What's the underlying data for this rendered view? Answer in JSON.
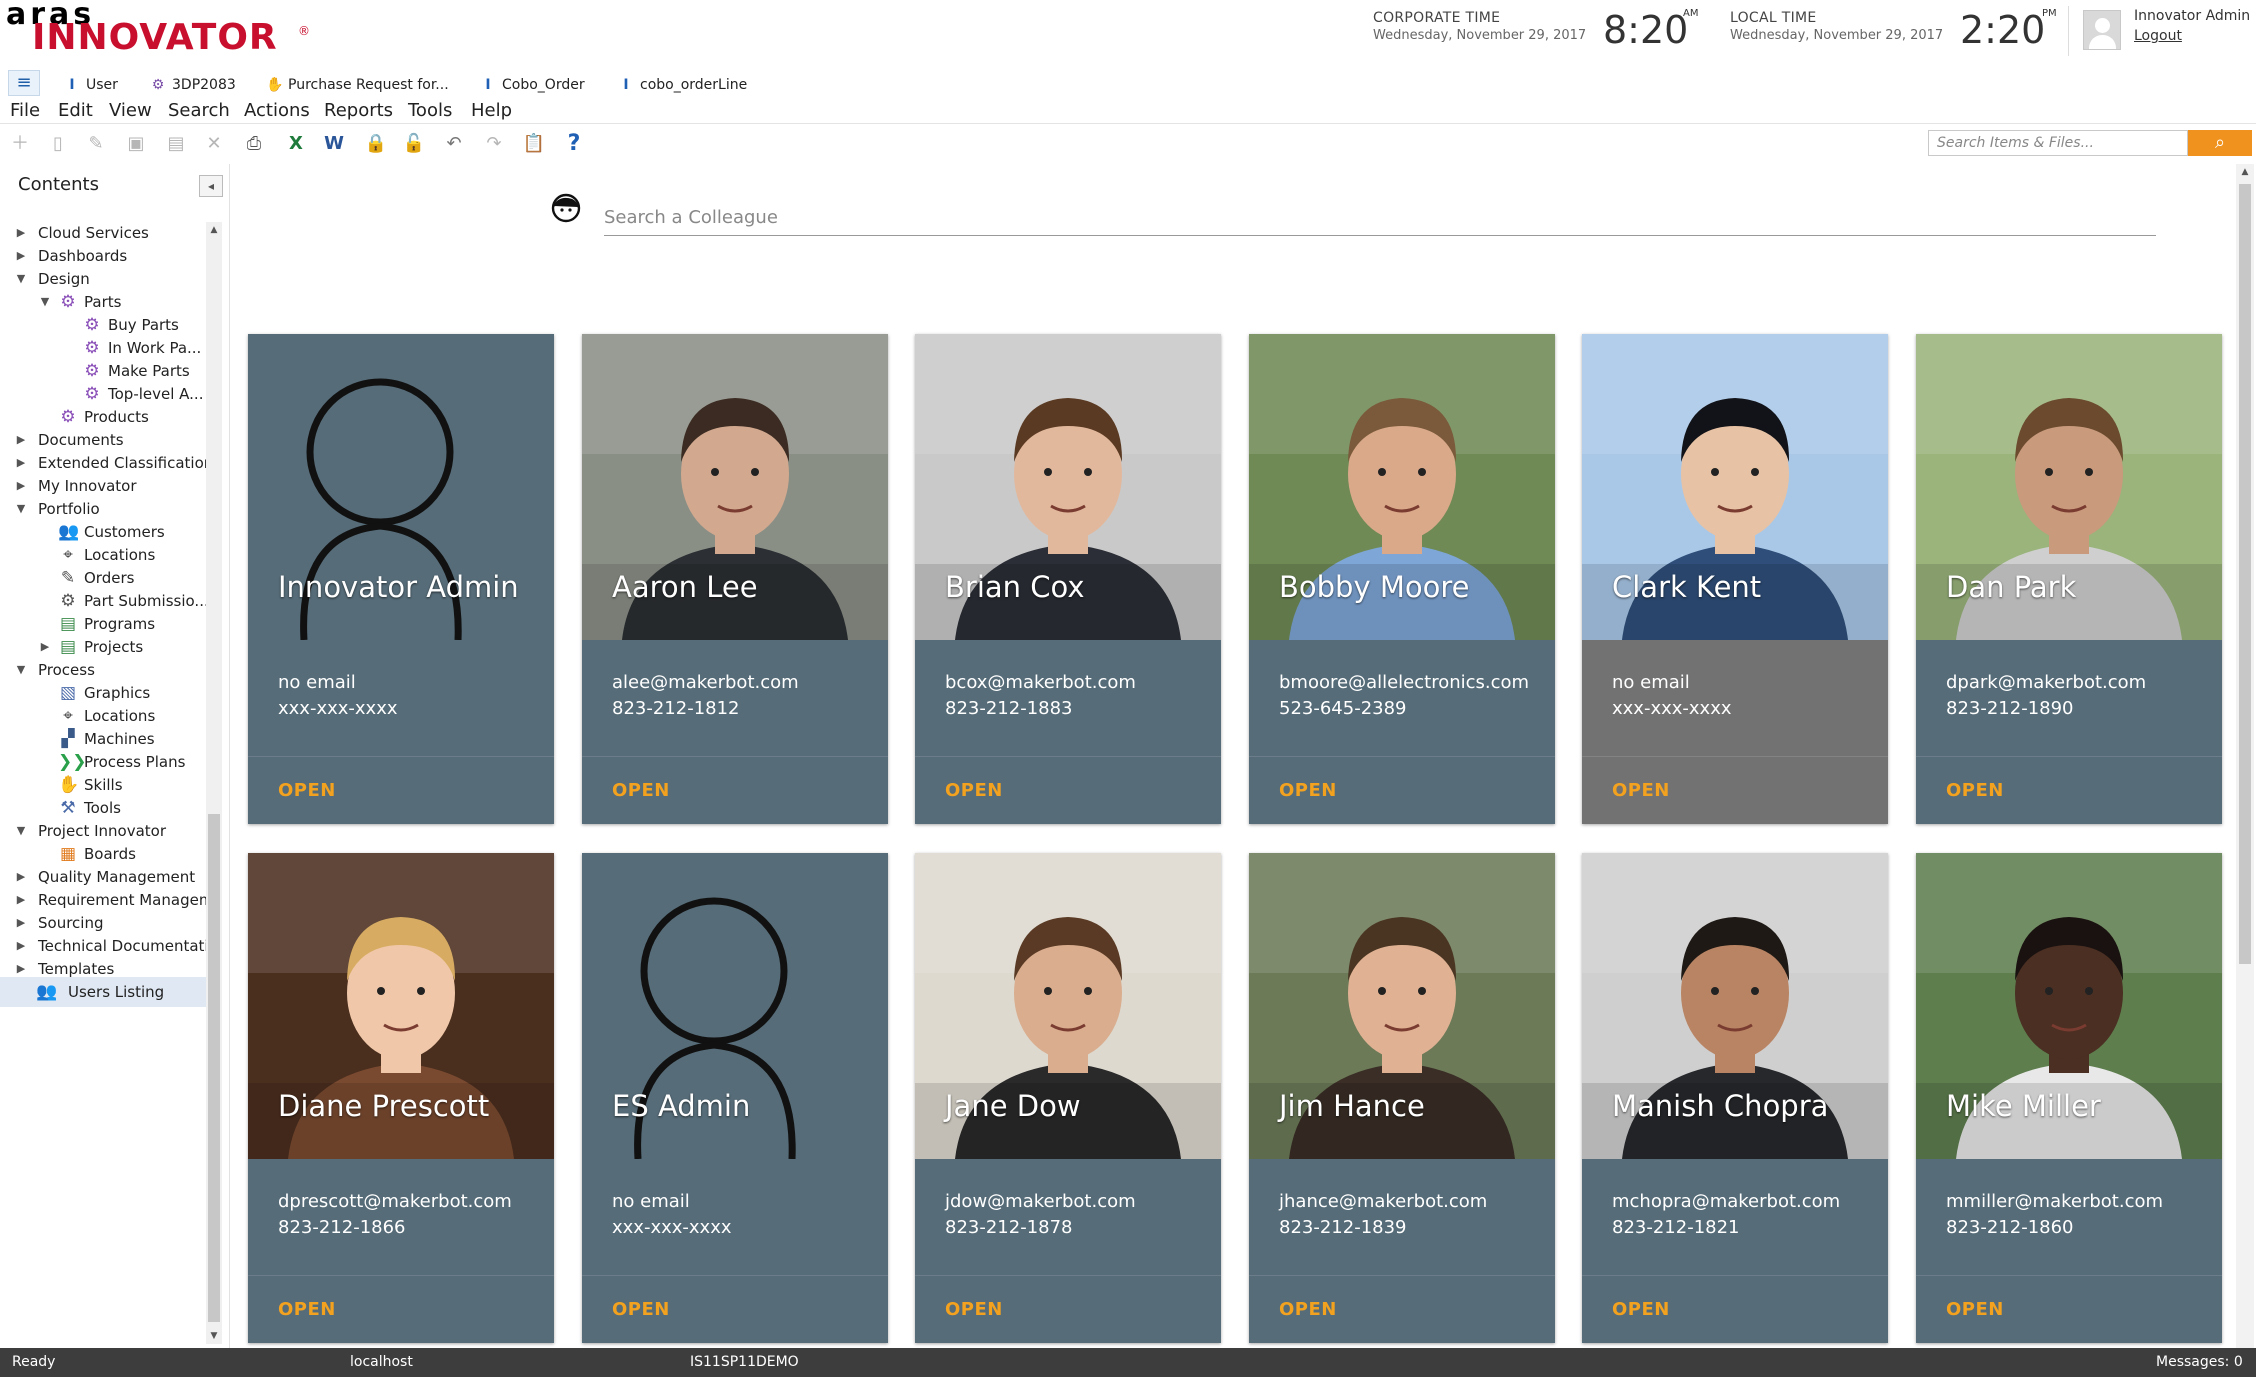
{
  "header": {
    "logo_top": "aras",
    "logo_main": "INNOVATOR",
    "logo_mark": "®",
    "corporate_time": {
      "label": "CORPORATE TIME",
      "date": "Wednesday, November 29, 2017",
      "time": "8:20",
      "ampm": "AM"
    },
    "local_time": {
      "label": "LOCAL TIME",
      "date": "Wednesday, November 29, 2017",
      "time": "2:20",
      "ampm": "PM"
    },
    "user_name": "Innovator Admin",
    "logout_label": "Logout"
  },
  "tabs": [
    {
      "label": "User",
      "icon": "user-type-icon"
    },
    {
      "label": "3DP2083",
      "icon": "part-gear-icon"
    },
    {
      "label": "Purchase Request for...",
      "icon": "purchase-request-icon"
    },
    {
      "label": "Cobo_Order",
      "icon": "itemtype-icon"
    },
    {
      "label": "cobo_orderLine",
      "icon": "itemtype-icon"
    }
  ],
  "menu": [
    "File",
    "Edit",
    "View",
    "Search",
    "Actions",
    "Reports",
    "Tools",
    "Help"
  ],
  "toolbar": {
    "icons": [
      "new-item-icon",
      "new-file-icon",
      "edit-icon",
      "save-icon",
      "save-close-icon",
      "delete-icon",
      "print-icon",
      "excel-icon",
      "word-icon",
      "lock-icon",
      "unlock-icon",
      "undo-icon",
      "redo-icon",
      "clipboard-icon",
      "help-icon"
    ],
    "search_placeholder": "Search Items & Files..."
  },
  "sidebar": {
    "title": "Contents",
    "items": [
      {
        "label": "Cloud Services",
        "level": 0,
        "arrow": "right"
      },
      {
        "label": "Dashboards",
        "level": 0,
        "arrow": "right"
      },
      {
        "label": "Design",
        "level": 0,
        "arrow": "down"
      },
      {
        "label": "Parts",
        "level": 1,
        "arrow": "down",
        "icon": "gear-icon"
      },
      {
        "label": "Buy Parts",
        "level": 2,
        "icon": "gear-icon"
      },
      {
        "label": "In Work Pa...",
        "level": 2,
        "icon": "gear-icon"
      },
      {
        "label": "Make Parts",
        "level": 2,
        "icon": "gear-icon"
      },
      {
        "label": "Top-level A...",
        "level": 2,
        "icon": "gear-icon"
      },
      {
        "label": "Products",
        "level": 1,
        "icon": "gear-icon"
      },
      {
        "label": "Documents",
        "level": 0,
        "arrow": "right"
      },
      {
        "label": "Extended Classification",
        "level": 0,
        "arrow": "right"
      },
      {
        "label": "My Innovator",
        "level": 0,
        "arrow": "right"
      },
      {
        "label": "Portfolio",
        "level": 0,
        "arrow": "down"
      },
      {
        "label": "Customers",
        "level": 1,
        "icon": "customers-icon"
      },
      {
        "label": "Locations",
        "level": 1,
        "icon": "location-icon"
      },
      {
        "label": "Orders",
        "level": 1,
        "icon": "orders-icon"
      },
      {
        "label": "Part Submissio...",
        "level": 1,
        "icon": "submission-icon"
      },
      {
        "label": "Programs",
        "level": 1,
        "icon": "programs-icon"
      },
      {
        "label": "Projects",
        "level": 1,
        "arrow": "right",
        "icon": "projects-icon"
      },
      {
        "label": "Process",
        "level": 0,
        "arrow": "down"
      },
      {
        "label": "Graphics",
        "level": 1,
        "icon": "graphics-icon"
      },
      {
        "label": "Locations",
        "level": 1,
        "icon": "location-icon"
      },
      {
        "label": "Machines",
        "level": 1,
        "icon": "machine-icon"
      },
      {
        "label": "Process Plans",
        "level": 1,
        "icon": "process-plan-icon"
      },
      {
        "label": "Skills",
        "level": 1,
        "icon": "skills-icon"
      },
      {
        "label": "Tools",
        "level": 1,
        "icon": "tools-icon"
      },
      {
        "label": "Project Innovator",
        "level": 0,
        "arrow": "down"
      },
      {
        "label": "Boards",
        "level": 1,
        "icon": "boards-icon"
      },
      {
        "label": "Quality Management",
        "level": 0,
        "arrow": "right"
      },
      {
        "label": "Requirement Managem...",
        "level": 0,
        "arrow": "right"
      },
      {
        "label": "Sourcing",
        "level": 0,
        "arrow": "right"
      },
      {
        "label": "Technical Documentati...",
        "level": 0,
        "arrow": "right"
      },
      {
        "label": "Templates",
        "level": 0,
        "arrow": "right"
      },
      {
        "label": "Users Listing",
        "level": 1,
        "icon": "users-icon",
        "selected": true
      }
    ]
  },
  "main": {
    "search_placeholder": "Search a Colleague",
    "open_label": "OPEN",
    "users": [
      {
        "name": "Innovator Admin",
        "email": "no email",
        "phone": "xxx-xxx-xxxx",
        "photo": "placeholder"
      },
      {
        "name": "Aaron Lee",
        "email": "alee@makerbot.com",
        "phone": "823-212-1812",
        "photo": "photo",
        "bg": "#8a8f86",
        "skin": "#d2a98f",
        "hair": "#3b2b22",
        "shirt": "#2c2f33"
      },
      {
        "name": "Brian Cox",
        "email": "bcox@makerbot.com",
        "phone": "823-212-1883",
        "photo": "photo",
        "bg": "#c9c9c9",
        "skin": "#e2b89c",
        "hair": "#5a3a22",
        "shirt": "#2b2e36"
      },
      {
        "name": "Bobby Moore",
        "email": "bmoore@allelectronics.com",
        "phone": "523-645-2389",
        "photo": "photo",
        "bg": "#6f8a55",
        "skin": "#d9a98a",
        "hair": "#7a5a3a",
        "shirt": "#7ea6d6"
      },
      {
        "name": "Clark Kent",
        "email": "no email",
        "phone": "xxx-xxx-xxxx",
        "photo": "photo",
        "bg": "#a9c8e8",
        "skin": "#e8c2a4",
        "hair": "#111318",
        "shirt": "#2f4f7a",
        "grey": true
      },
      {
        "name": "Dan Park",
        "email": "dpark@makerbot.com",
        "phone": "823-212-1890",
        "photo": "photo",
        "bg": "#9ab47c",
        "skin": "#c99a7c",
        "hair": "#6b4a2e",
        "shirt": "#cfcfcf"
      },
      {
        "name": "Diane Prescott",
        "email": "dprescott@makerbot.com",
        "phone": "823-212-1866",
        "photo": "photo",
        "bg": "#4a2e1e",
        "skin": "#f0c7a8",
        "hair": "#d7ac62",
        "shirt": "#7a4a30"
      },
      {
        "name": "ES Admin",
        "email": "no email",
        "phone": "xxx-xxx-xxxx",
        "photo": "placeholder"
      },
      {
        "name": "Jane Dow",
        "email": "jdow@makerbot.com",
        "phone": "823-212-1878",
        "photo": "photo",
        "bg": "#ddd9cf",
        "skin": "#d9ad8e",
        "hair": "#5a3a24",
        "shirt": "#2a2a2a"
      },
      {
        "name": "Jim Hance",
        "email": "jhance@makerbot.com",
        "phone": "823-212-1839",
        "photo": "photo",
        "bg": "#6c7a58",
        "skin": "#e0b293",
        "hair": "#4a3522",
        "shirt": "#3a2e26"
      },
      {
        "name": "Manish Chopra",
        "email": "mchopra@makerbot.com",
        "phone": "823-212-1821",
        "photo": "photo",
        "bg": "#cfcfcf",
        "skin": "#b98463",
        "hair": "#1e1915",
        "shirt": "#26282c"
      },
      {
        "name": "Mike Miller",
        "email": "mmiller@makerbot.com",
        "phone": "823-212-1860",
        "photo": "photo",
        "bg": "#5e7e4e",
        "skin": "#4a2f22",
        "hair": "#1a1210",
        "shirt": "#e8e8e8"
      }
    ]
  },
  "status": {
    "state": "Ready",
    "server": "localhost",
    "database": "IS11SP11DEMO",
    "messages": "Messages:  0"
  },
  "colors": {
    "brand_red": "#c8102e",
    "card_bg": "#566c78",
    "card_grey": "#727272",
    "open_accent": "#f3a21f",
    "search_button": "#f0931e"
  }
}
